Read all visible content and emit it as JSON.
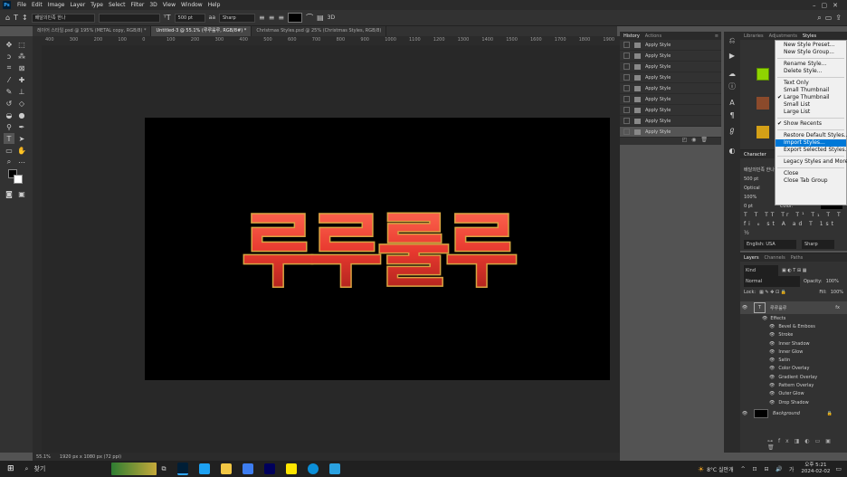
{
  "app": {
    "logo": "Ps"
  },
  "menu": [
    "File",
    "Edit",
    "Image",
    "Layer",
    "Type",
    "Select",
    "Filter",
    "3D",
    "View",
    "Window",
    "Help"
  ],
  "options": {
    "font_family": "배달의민족 한나",
    "font_style": "",
    "font_size": "500 pt",
    "antialias": "Sharp",
    "threed_label": "3D"
  },
  "tabs": [
    {
      "label": "레이어 스타일.psd @ 195% (METAL copy, RGB/8) *"
    },
    {
      "label": "Untitled-3 @ 55.1% (루루룰루, RGB/8#) *"
    },
    {
      "label": "Christmas Styles.psd @ 25% (Christmas Styles, RGB/8)"
    }
  ],
  "ruler_ticks": [
    "400",
    "300",
    "200",
    "100",
    "0",
    "100",
    "200",
    "300",
    "400",
    "500",
    "600",
    "700",
    "800",
    "900",
    "1000",
    "1100",
    "1200",
    "1300",
    "1400",
    "1500",
    "1600",
    "1700",
    "1800",
    "1900"
  ],
  "canvas_text": "루루룰루",
  "status": {
    "zoom": "55.1%",
    "doc_size": "1920 px x 1080 px (72 ppi)"
  },
  "history": {
    "tabs": [
      "History",
      "Actions"
    ],
    "items": [
      "Apply Style",
      "Apply Style",
      "Apply Style",
      "Apply Style",
      "Apply Style",
      "Apply Style",
      "Apply Style",
      "Apply Style",
      "Apply Style"
    ]
  },
  "right_tabs": [
    "Libraries",
    "Adjustments",
    "Styles"
  ],
  "styles_menu": {
    "items": [
      {
        "label": "New Style Preset...",
        "check": false,
        "highlight": false
      },
      {
        "label": "New Style Group...",
        "check": false,
        "highlight": false
      },
      {
        "sep": true
      },
      {
        "label": "Rename Style...",
        "check": false,
        "highlight": false
      },
      {
        "label": "Delete Style...",
        "check": false,
        "highlight": false
      },
      {
        "sep": true
      },
      {
        "label": "Text Only",
        "check": false,
        "highlight": false
      },
      {
        "label": "Small Thumbnail",
        "check": false,
        "highlight": false
      },
      {
        "label": "Large Thumbnail",
        "check": true,
        "highlight": false
      },
      {
        "label": "Small List",
        "check": false,
        "highlight": false
      },
      {
        "label": "Large List",
        "check": false,
        "highlight": false
      },
      {
        "sep": true
      },
      {
        "label": "Show Recents",
        "check": true,
        "highlight": false
      },
      {
        "sep": true
      },
      {
        "label": "Restore Default Styles...",
        "check": false,
        "highlight": false
      },
      {
        "label": "Import Styles...",
        "check": false,
        "highlight": true
      },
      {
        "label": "Export Selected Styles...",
        "check": false,
        "highlight": false
      },
      {
        "sep": true
      },
      {
        "label": "Legacy Styles and More",
        "check": false,
        "highlight": false
      },
      {
        "sep": true
      },
      {
        "label": "Close",
        "check": false,
        "highlight": false
      },
      {
        "label": "Close Tab Group",
        "check": false,
        "highlight": false
      }
    ]
  },
  "character": {
    "tab": "Character",
    "font": "배달의민족 한나",
    "size": "500 pt",
    "kerning": "Optical",
    "scale": "100%",
    "tracking": "0 pt",
    "color_label": "Color:",
    "language": "English: USA",
    "antialias": "Sharp"
  },
  "layers": {
    "tabs": [
      "Layers",
      "Channels",
      "Paths"
    ],
    "kind": "Kind",
    "blend": "Normal",
    "opacity_label": "Opacity:",
    "opacity": "100%",
    "lock_label": "Lock:",
    "fill_label": "Fill:",
    "fill": "100%",
    "text_layer": "루루룰루",
    "fx": "fx",
    "effects_label": "Effects",
    "effects": [
      "Bevel & Emboss",
      "Stroke",
      "Inner Shadow",
      "Inner Glow",
      "Satin",
      "Color Overlay",
      "Gradient Overlay",
      "Pattern Overlay",
      "Outer Glow",
      "Drop Shadow"
    ],
    "background": "Background"
  },
  "taskbar": {
    "search": "찾기",
    "weather": "8°C 실안개",
    "ime": "가",
    "time": "오후 5:21",
    "date": "2024-02-02"
  },
  "colors": {
    "accent": "#0078d7",
    "text_fill": "#e8392f",
    "text_rim": "#d9a441"
  }
}
